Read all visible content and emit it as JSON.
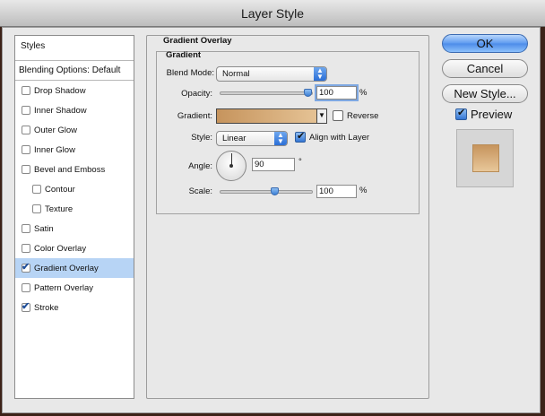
{
  "window": {
    "title": "Layer Style"
  },
  "sidebar": {
    "header": "Styles",
    "blending": "Blending Options: Default",
    "items": [
      {
        "label": "Drop Shadow",
        "checked": false,
        "sub": false,
        "selected": false
      },
      {
        "label": "Inner Shadow",
        "checked": false,
        "sub": false,
        "selected": false
      },
      {
        "label": "Outer Glow",
        "checked": false,
        "sub": false,
        "selected": false
      },
      {
        "label": "Inner Glow",
        "checked": false,
        "sub": false,
        "selected": false
      },
      {
        "label": "Bevel and Emboss",
        "checked": false,
        "sub": false,
        "selected": false
      },
      {
        "label": "Contour",
        "checked": false,
        "sub": true,
        "selected": false
      },
      {
        "label": "Texture",
        "checked": false,
        "sub": true,
        "selected": false
      },
      {
        "label": "Satin",
        "checked": false,
        "sub": false,
        "selected": false
      },
      {
        "label": "Color Overlay",
        "checked": false,
        "sub": false,
        "selected": false
      },
      {
        "label": "Gradient Overlay",
        "checked": true,
        "sub": false,
        "selected": true
      },
      {
        "label": "Pattern Overlay",
        "checked": false,
        "sub": false,
        "selected": false
      },
      {
        "label": "Stroke",
        "checked": true,
        "sub": false,
        "selected": false
      }
    ]
  },
  "panel": {
    "group_title": "Gradient Overlay",
    "sub_title": "Gradient",
    "blend_mode_label": "Blend Mode:",
    "blend_mode_value": "Normal",
    "opacity_label": "Opacity:",
    "opacity_value": "100",
    "opacity_unit": "%",
    "opacity_level": 100,
    "gradient_label": "Gradient:",
    "gradient_colors": [
      "#c6945d",
      "#e8c79a"
    ],
    "reverse_label": "Reverse",
    "reverse_checked": false,
    "style_label": "Style:",
    "style_value": "Linear",
    "align_label": "Align with Layer",
    "align_checked": true,
    "angle_label": "Angle:",
    "angle_value": "90",
    "angle_unit": "°",
    "scale_label": "Scale:",
    "scale_value": "100",
    "scale_unit": "%",
    "scale_level": 100
  },
  "buttons": {
    "ok": "OK",
    "cancel": "Cancel",
    "new_style": "New Style...",
    "preview_label": "Preview",
    "preview_checked": true
  }
}
